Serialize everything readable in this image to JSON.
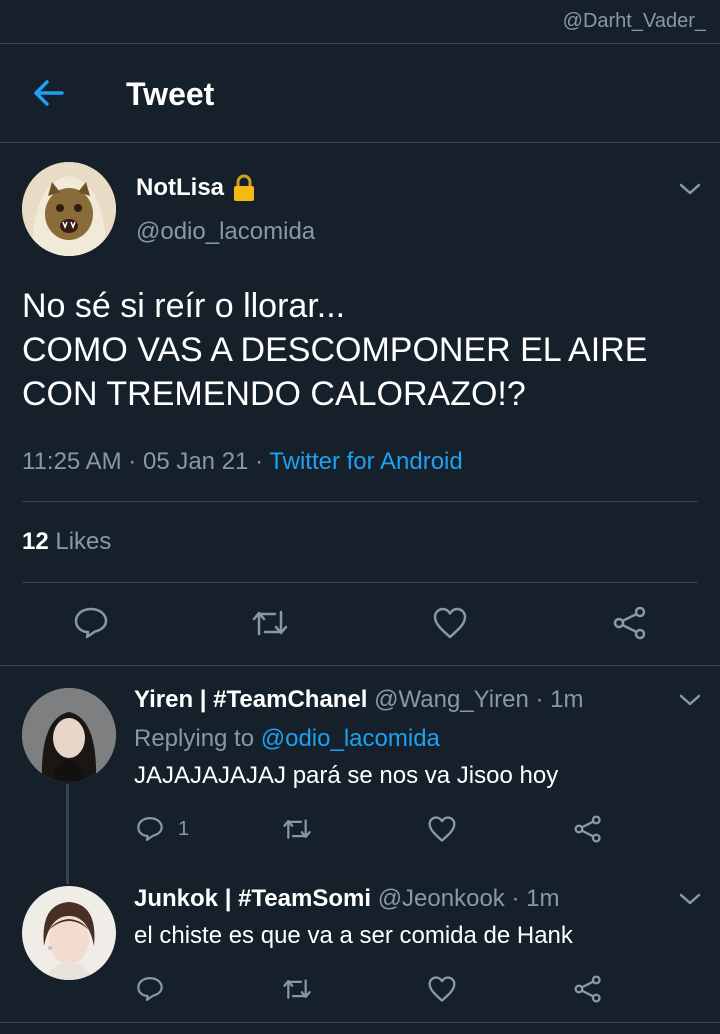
{
  "watermark": "@Darht_Vader_",
  "header": {
    "title": "Tweet",
    "back_icon": "arrow-left-icon"
  },
  "tweet": {
    "display_name": "NotLisa",
    "lock_icon": "lock-icon",
    "handle": "@odio_lacomida",
    "text_lines": [
      "No sé si reír o llorar...",
      "COMO VAS A DESCOMPONER EL AIRE",
      "CON TREMENDO CALORAZO!?"
    ],
    "time": "11:25 AM",
    "date": "05 Jan 21",
    "source": "Twitter for Android",
    "likes_count": "12",
    "likes_label": "Likes"
  },
  "replies": [
    {
      "display_name": "Yiren | #TeamChanel",
      "handle": "@Wang_Yiren",
      "time": "1m",
      "replying_to_label": "Replying to",
      "replying_to_handle": "@odio_lacomida",
      "text": "JAJAJAJAJAJ pará se nos va Jisoo hoy",
      "reply_count": "1"
    },
    {
      "display_name": "Junkok | #TeamSomi",
      "handle": "@Jeonkook",
      "time": "1m",
      "text": "el chiste es que va a ser comida de Hank",
      "reply_count": ""
    }
  ],
  "colors": {
    "background": "#15202b",
    "accent": "#1da1f2",
    "secondary": "#8899a6",
    "divider": "#38444d"
  }
}
